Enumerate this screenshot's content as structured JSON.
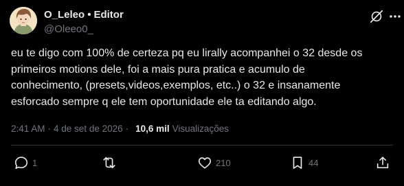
{
  "author": {
    "display_name": "O_Leleo",
    "role_badge": "Editor",
    "handle": "@Oleeo0_"
  },
  "post": {
    "text": "eu te digo com 100% de certeza pq eu lirally acompanhei o 32 desde os\nprimeiros motions dele, foi a mais pura pratica e acumulo de\nconhecimento, (presets,videos,exemplos, etc..) o 32 e insanamente\nesforcado sempre q ele tem oportunidade ele ta editando algo.",
    "time": "2:41 AM",
    "separator": "·",
    "date": "4 de set de 2026",
    "views_count": "10,6 mil",
    "views_label": "Visualizações"
  },
  "actions": {
    "replies": "1",
    "reposts": "",
    "likes": "210",
    "bookmarks": "44"
  },
  "colors": {
    "background": "#000000",
    "primary_text": "#e7e9ea",
    "secondary_text": "#71767b",
    "divider": "#2f3336"
  },
  "icons": [
    "grok-icon",
    "more-icon",
    "reply-icon",
    "repost-icon",
    "like-icon",
    "bookmark-icon",
    "share-icon"
  ]
}
